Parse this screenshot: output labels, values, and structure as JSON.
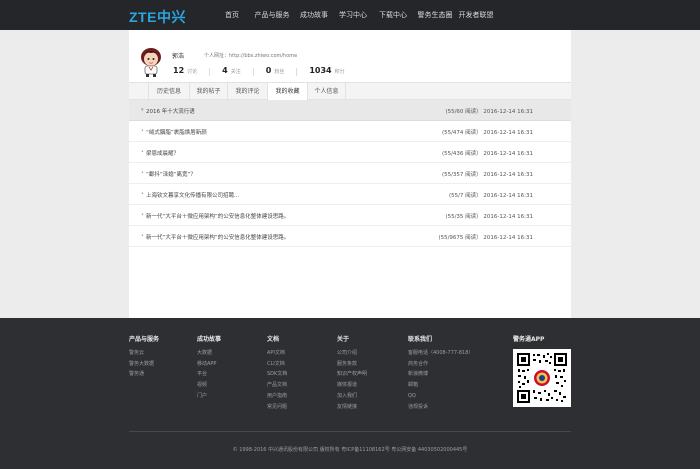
{
  "header": {
    "logo": "ZTE中兴",
    "nav": [
      {
        "label": "首页",
        "active": true
      },
      {
        "label": "产品与服务",
        "active": false
      },
      {
        "label": "成功故事",
        "active": false
      },
      {
        "label": "学习中心",
        "active": false
      },
      {
        "label": "下载中心",
        "active": false
      },
      {
        "label": "警务生态圈",
        "active": false
      },
      {
        "label": "开发者联盟",
        "active": false
      }
    ]
  },
  "profile": {
    "username": "郭浩",
    "homepage": "个人网址：http://bbs.zhiwo.com/home",
    "stats": [
      {
        "num": "12",
        "label": "讨论"
      },
      {
        "num": "4",
        "label": "关注"
      },
      {
        "num": "0",
        "label": "粉丝"
      },
      {
        "num": "1034",
        "label": "积分"
      }
    ]
  },
  "tabs": [
    {
      "label": "历史信息",
      "active": false
    },
    {
      "label": "我的帖子",
      "active": false
    },
    {
      "label": "我的评论",
      "active": false
    },
    {
      "label": "我的收藏",
      "active": true
    },
    {
      "label": "个人信息",
      "active": false
    }
  ],
  "rows": [
    {
      "title": "2016 年十大流行语",
      "meta": "(55/60 阅读） 2016-12-14 16:31",
      "bullet": "▾"
    },
    {
      "title": "“绒式胭脂”裹脂焕唇新颜",
      "meta": "(55/474 阅读） 2016-12-14 16:31",
      "bullet": "•"
    },
    {
      "title": "梁恩成晨耀？",
      "meta": "(55/436 阅读） 2016-12-14 16:31",
      "bullet": "•"
    },
    {
      "title": "“鄱抖”泽媳“离宽”？",
      "meta": "(55/357 阅读） 2016-12-14 16:31",
      "bullet": "•"
    },
    {
      "title": "上海钦文暮享文化传播有限公司招聘...",
      "meta": "(55/7 阅读） 2016-12-14 16:31",
      "bullet": "•"
    },
    {
      "title": "新一代“大平台＋微应用架构”的公安信息化整体建设思路。",
      "meta": "(55/35 阅读） 2016-12-14 16:31",
      "bullet": "•"
    },
    {
      "title": "新一代“大平台＋微应用架构”的公安信息化整体建设思路。",
      "meta": "(55/9675 阅读） 2016-12-14 16:31",
      "bullet": "•"
    }
  ],
  "footer": {
    "columns": [
      {
        "title": "产品与服务",
        "links": [
          "警务云",
          "警务大数据",
          "警务通"
        ]
      },
      {
        "title": "成功故事",
        "links": [
          "大数据",
          "移动APP",
          "平台",
          "视频",
          "门户"
        ]
      },
      {
        "title": "文档",
        "links": [
          "API文档",
          "CLI文档",
          "SDK文档",
          "产品文档",
          "用户指南",
          "常见问题"
        ]
      },
      {
        "title": "关于",
        "links": [
          "公司介绍",
          "服务条款",
          "知识产权声明",
          "媒体报道",
          "加入我们",
          "友情链接"
        ]
      },
      {
        "title": "联系我们",
        "links": [
          "客服电话（4008-777-818）",
          "商务合作",
          "新浪微博",
          "邮箱",
          "QQ",
          "违规投诉"
        ]
      },
      {
        "title": "警务通APP",
        "links": []
      }
    ],
    "copyright": "© 1998-2016 中兴通讯股份有限公司 版权所有 粤ICP备11108162号 粤公网安备 44030502000445号"
  }
}
